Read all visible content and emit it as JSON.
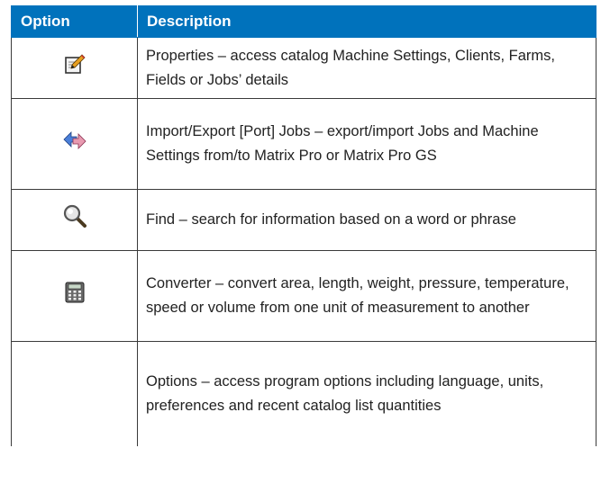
{
  "table": {
    "headers": {
      "option": "Option",
      "description": "Description"
    },
    "rows": [
      {
        "icon": "properties-edit-icon",
        "description": "Properties – access catalog Machine Settings, Clients, Farms, Fields or Jobs’ details"
      },
      {
        "icon": "import-export-arrows-icon",
        "description": "Import/Export [Port] Jobs – export/import Jobs and Machine Settings from/to Matrix Pro or Matrix Pro GS"
      },
      {
        "icon": "magnifier-find-icon",
        "description": "Find – search for information based on a word or phrase"
      },
      {
        "icon": "calculator-converter-icon",
        "description": "Converter – convert area, length, weight, pressure, temperature, speed or volume from one unit of measurement to another"
      },
      {
        "icon": "",
        "description": "Options – access program options including language, units, preferences and recent catalog list quantities"
      }
    ]
  },
  "colors": {
    "header_bg": "#0072bc",
    "header_text": "#ffffff",
    "border": "#3a3a3a"
  }
}
